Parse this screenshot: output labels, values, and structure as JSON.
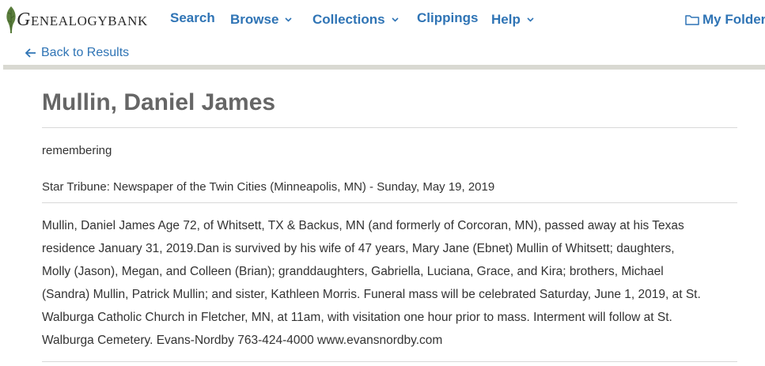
{
  "brand": {
    "logo_text_first": "G",
    "logo_text_rest": "ENEALOGYBANK"
  },
  "nav": {
    "items": [
      {
        "label": "Search",
        "has_dropdown": false
      },
      {
        "label": "Browse",
        "has_dropdown": true
      },
      {
        "label": "Collections",
        "has_dropdown": true
      },
      {
        "label": "Clippings",
        "has_dropdown": false
      },
      {
        "label": "Help",
        "has_dropdown": true
      }
    ],
    "folder_label": "My Folder",
    "back_label": "Back to Results"
  },
  "article": {
    "title": "Mullin, Daniel James",
    "category": "remembering",
    "source": "Star Tribune: Newspaper of the Twin Cities (Minneapolis, MN) - Sunday, May 19, 2019",
    "body_lines": [
      "Mullin, Daniel James Age 72, of Whitsett, TX & Backus, MN (and formerly of Corcoran, MN), passed away at his Texas",
      "residence January 31, 2019.Dan is survived by his wife of 47 years, Mary Jane (Ebnet) Mullin of Whitsett; daughters,",
      "Molly (Jason), Megan, and Colleen (Brian); granddaughters, Gabriella, Luciana, Grace, and Kira; brothers, Michael",
      "(Sandra) Mullin, Patrick Mullin; and sister, Kathleen Morris. Funeral mass will be celebrated Saturday, June 1, 2019, at St.",
      "Walburga Catholic Church in Fletcher, MN, at 11am, with visitation one hour prior to mass. Interment will follow at St.",
      "Walburga Cemetery. Evans-Nordby 763-424-4000 www.evansnordby.com"
    ]
  },
  "colors": {
    "link": "#2f74b5",
    "title": "#666666",
    "text": "#333333",
    "rule": "#d9d9d9",
    "leaf": "#5a7d3c"
  },
  "icons": {
    "logo": "leaf-icon",
    "folder": "folder-icon",
    "back": "arrow-left-icon",
    "dropdown": "chevron-down-icon"
  }
}
